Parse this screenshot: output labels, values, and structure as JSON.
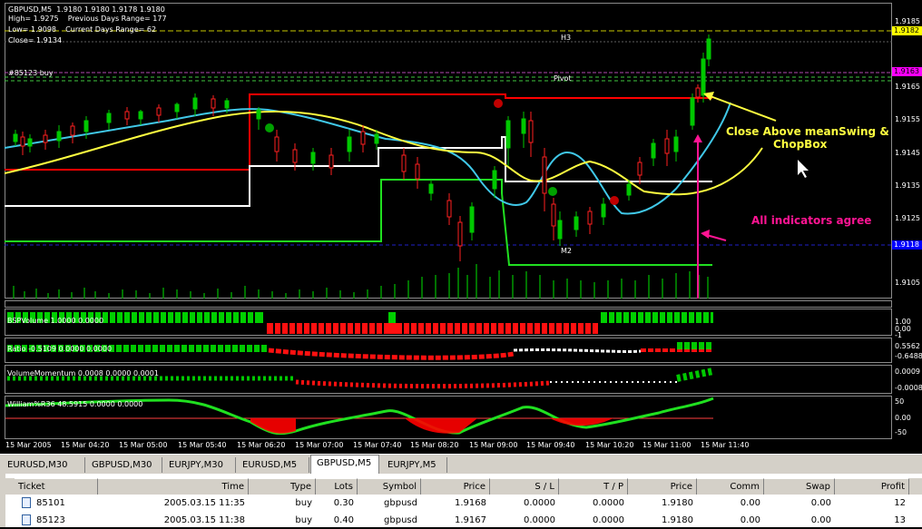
{
  "symbol_header": "GBPUSD,M5  1.9180 1.9180 1.9178 1.9180",
  "overlay": {
    "high": "High= 1.9275    Previous Days Range= 177",
    "low": "Low= 1.9098    Current Days Range= 62",
    "close": "Close= 1.9134",
    "order_label": "#85123 buy",
    "h3": "H3",
    "pivot": "Pivot",
    "m2": "M2"
  },
  "price_axis": [
    "1.9185",
    "1.9165",
    "1.9155",
    "1.9145",
    "1.9135",
    "1.9125",
    "1.9115",
    "1.9105"
  ],
  "price_tags": {
    "bid": "1.9182",
    "order": "1.9163",
    "blue": "1.9118"
  },
  "subpanels": {
    "bsp": {
      "label": "BSPVolume 1.0000 0.0000",
      "axis": [
        "1.00",
        "0.00",
        "-1"
      ]
    },
    "ratio": {
      "label": "Ratio -0.5109 0.0000 0.0000",
      "axis": [
        "0.5562",
        "-0.6488"
      ]
    },
    "momentum": {
      "label": "VolumeMomentum 0.0008 0.0000 0.0001",
      "axis": [
        "0.0009",
        "-0.0008"
      ]
    },
    "williams": {
      "label": "William%R36 48.5915 0.0000 0.0000",
      "axis": [
        "50",
        "0.00",
        "-50"
      ]
    }
  },
  "time_axis": [
    "15 Mar 2005",
    "15 Mar 04:20",
    "15 Mar 05:00",
    "15 Mar 05:40",
    "15 Mar 06:20",
    "15 Mar 07:00",
    "15 Mar 07:40",
    "15 Mar 08:20",
    "15 Mar 09:00",
    "15 Mar 09:40",
    "15 Mar 10:20",
    "15 Mar 11:00",
    "15 Mar 11:40"
  ],
  "annotations": {
    "close_above_1": "Close Above meanSwing &",
    "close_above_2": "ChopBox",
    "agree": "All indicators agree"
  },
  "chart_tabs": [
    "EURUSD,M30",
    "GBPUSD,M30",
    "EURJPY,M30",
    "EURUSD,M5",
    "GBPUSD,M5",
    "EURJPY,M5"
  ],
  "active_tab": "GBPUSD,M5",
  "terminal": {
    "columns": [
      "Ticket",
      "Time",
      "Type",
      "Lots",
      "Symbol",
      "Price",
      "S / L",
      "T / P",
      "Price",
      "Comm",
      "Swap",
      "Profit"
    ],
    "rows": [
      [
        "85101",
        "2005.03.15 11:35",
        "buy",
        "0.30",
        "gbpusd",
        "1.9168",
        "0.0000",
        "0.0000",
        "1.9180",
        "0.00",
        "0.00",
        "12"
      ],
      [
        "85123",
        "2005.03.15 11:38",
        "buy",
        "0.40",
        "gbpusd",
        "1.9167",
        "0.0000",
        "0.0000",
        "1.9180",
        "0.00",
        "0.00",
        "13"
      ]
    ]
  },
  "colors": {
    "background": "#000000",
    "bull": "#00c800",
    "bear": "#ff0000",
    "cyan": "#40c8e8",
    "yellow": "#ffff40",
    "magenta": "#ff1493",
    "white": "#ffffff"
  }
}
